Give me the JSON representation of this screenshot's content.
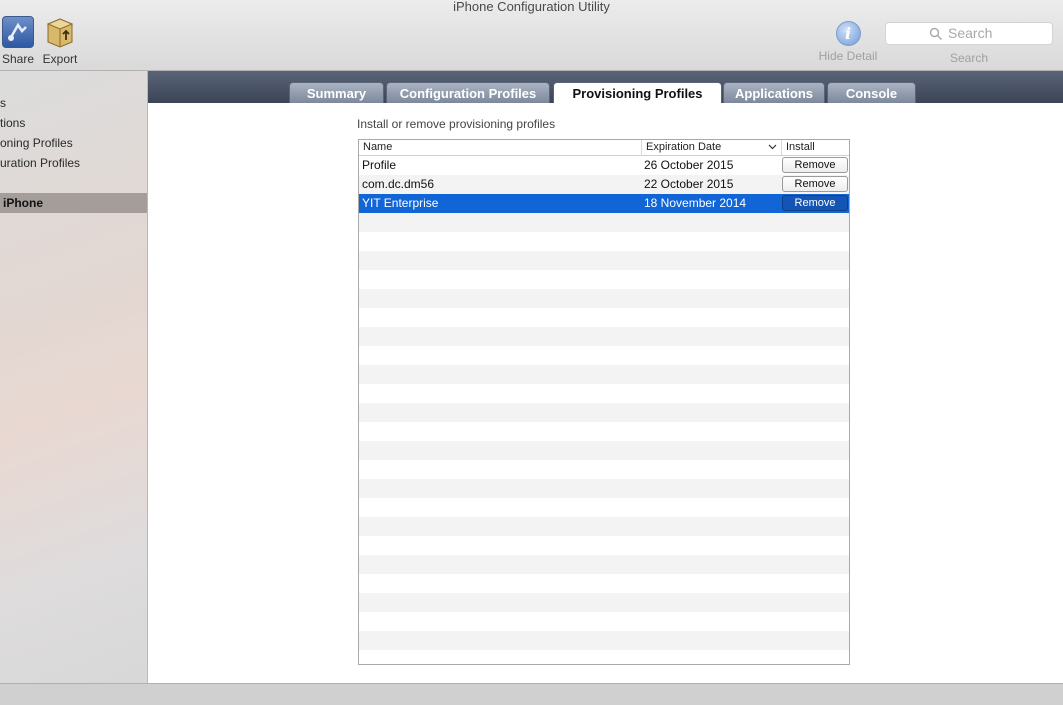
{
  "window": {
    "title": "iPhone Configuration Utility"
  },
  "toolbar": {
    "share_label": "Share",
    "export_label": "Export",
    "hide_detail_label": "Hide Detail",
    "search_placeholder": "Search",
    "search_caption": "Search"
  },
  "sidebar": {
    "items": [
      {
        "label": "s"
      },
      {
        "label": "tions"
      },
      {
        "label": "oning Profiles"
      },
      {
        "label": "uration Profiles"
      },
      {
        "label": "iPhone"
      }
    ],
    "selected": "iPhone"
  },
  "tabs": [
    {
      "label": "Summary"
    },
    {
      "label": "Configuration Profiles"
    },
    {
      "label": "Provisioning Profiles"
    },
    {
      "label": "Applications"
    },
    {
      "label": "Console"
    }
  ],
  "active_tab": "Provisioning Profiles",
  "main": {
    "section_title": "Install or remove provisioning profiles",
    "table": {
      "columns": [
        "Name",
        "Expiration Date",
        "Install"
      ],
      "rows": [
        {
          "name": "Profile",
          "expiration": "26 October 2015",
          "action": "Remove",
          "selected": false
        },
        {
          "name": "com.dc.dm56",
          "expiration": "22 October 2015",
          "action": "Remove",
          "selected": false
        },
        {
          "name": "YIT Enterprise",
          "expiration": "18 November 2014",
          "action": "Remove",
          "selected": true
        }
      ]
    }
  },
  "colors": {
    "selection": "#1265d6",
    "tabbar": "#3c4556",
    "sidebar_selected": "#a59d99"
  }
}
